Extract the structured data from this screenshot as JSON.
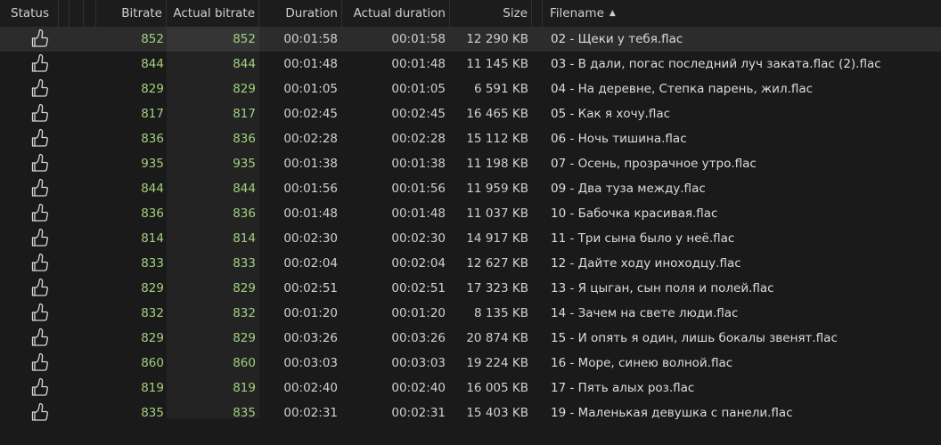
{
  "columns": {
    "status": "Status",
    "bitrate": "Bitrate",
    "actual_bitrate": "Actual bitrate",
    "duration": "Duration",
    "actual_duration": "Actual duration",
    "size": "Size",
    "filename": "Filename",
    "sort_indicator": "▲"
  },
  "colors": {
    "bitrate_green": "#a3d07e",
    "background": "#1a1a1a"
  },
  "rows": [
    {
      "status": "thumbs-up-icon",
      "bitrate": "852",
      "actual_bitrate": "852",
      "duration": "00:01:58",
      "actual_duration": "00:01:58",
      "size": "12 290 KB",
      "filename": "02 - Щеки у тебя.flac",
      "selected": true
    },
    {
      "status": "thumbs-up-icon",
      "bitrate": "844",
      "actual_bitrate": "844",
      "duration": "00:01:48",
      "actual_duration": "00:01:48",
      "size": "11 145 KB",
      "filename": "03 - В дали, погас последний луч заката.flac (2).flac"
    },
    {
      "status": "thumbs-up-icon",
      "bitrate": "829",
      "actual_bitrate": "829",
      "duration": "00:01:05",
      "actual_duration": "00:01:05",
      "size": "6 591 KB",
      "filename": "04 - На деревне, Степка парень, жил.flac"
    },
    {
      "status": "thumbs-up-icon",
      "bitrate": "817",
      "actual_bitrate": "817",
      "duration": "00:02:45",
      "actual_duration": "00:02:45",
      "size": "16 465 KB",
      "filename": "05 - Как я хочу.flac"
    },
    {
      "status": "thumbs-up-icon",
      "bitrate": "836",
      "actual_bitrate": "836",
      "duration": "00:02:28",
      "actual_duration": "00:02:28",
      "size": "15 112 KB",
      "filename": "06 - Ночь тишина.flac"
    },
    {
      "status": "thumbs-up-icon",
      "bitrate": "935",
      "actual_bitrate": "935",
      "duration": "00:01:38",
      "actual_duration": "00:01:38",
      "size": "11 198 KB",
      "filename": "07 - Осень, прозрачное утро.flac"
    },
    {
      "status": "thumbs-up-icon",
      "bitrate": "844",
      "actual_bitrate": "844",
      "duration": "00:01:56",
      "actual_duration": "00:01:56",
      "size": "11 959 KB",
      "filename": "09 - Два туза между.flac"
    },
    {
      "status": "thumbs-up-icon",
      "bitrate": "836",
      "actual_bitrate": "836",
      "duration": "00:01:48",
      "actual_duration": "00:01:48",
      "size": "11 037 KB",
      "filename": "10 - Бабочка красивая.flac"
    },
    {
      "status": "thumbs-up-icon",
      "bitrate": "814",
      "actual_bitrate": "814",
      "duration": "00:02:30",
      "actual_duration": "00:02:30",
      "size": "14 917 KB",
      "filename": "11 - Три сына было у неё.flac"
    },
    {
      "status": "thumbs-up-icon",
      "bitrate": "833",
      "actual_bitrate": "833",
      "duration": "00:02:04",
      "actual_duration": "00:02:04",
      "size": "12 627 KB",
      "filename": "12 - Дайте ходу иноходцу.flac"
    },
    {
      "status": "thumbs-up-icon",
      "bitrate": "829",
      "actual_bitrate": "829",
      "duration": "00:02:51",
      "actual_duration": "00:02:51",
      "size": "17 323 KB",
      "filename": "13 - Я цыган, сын поля и полей.flac"
    },
    {
      "status": "thumbs-up-icon",
      "bitrate": "832",
      "actual_bitrate": "832",
      "duration": "00:01:20",
      "actual_duration": "00:01:20",
      "size": "8 135 KB",
      "filename": "14 - Зачем на свете люди.flac"
    },
    {
      "status": "thumbs-up-icon",
      "bitrate": "829",
      "actual_bitrate": "829",
      "duration": "00:03:26",
      "actual_duration": "00:03:26",
      "size": "20 874 KB",
      "filename": "15 - И опять я один, лишь бокалы звенят.flac"
    },
    {
      "status": "thumbs-up-icon",
      "bitrate": "860",
      "actual_bitrate": "860",
      "duration": "00:03:03",
      "actual_duration": "00:03:03",
      "size": "19 224 KB",
      "filename": "16 - Море, синею волной.flac"
    },
    {
      "status": "thumbs-up-icon",
      "bitrate": "819",
      "actual_bitrate": "819",
      "duration": "00:02:40",
      "actual_duration": "00:02:40",
      "size": "16 005 KB",
      "filename": "17 - Пять алых роз.flac"
    },
    {
      "status": "thumbs-up-icon",
      "bitrate": "835",
      "actual_bitrate": "835",
      "duration": "00:02:31",
      "actual_duration": "00:02:31",
      "size": "15 403 KB",
      "filename": "19 - Маленькая девушка с панели.flac"
    }
  ]
}
